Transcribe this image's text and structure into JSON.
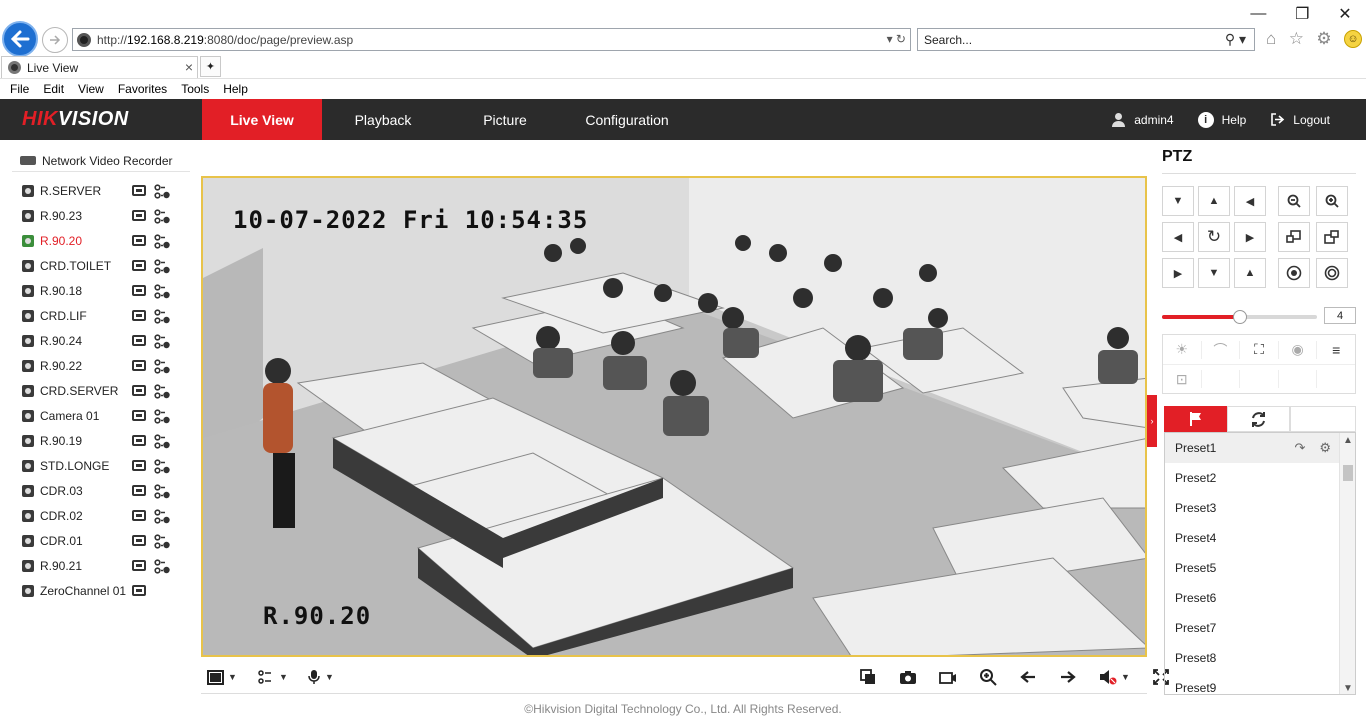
{
  "browser": {
    "url_prefix": "http://",
    "url_host": "192.168.8.219",
    "url_rest": ":8080/doc/page/preview.asp",
    "search_placeholder": "Search...",
    "tab_title": "Live View",
    "menu": [
      "File",
      "Edit",
      "View",
      "Favorites",
      "Tools",
      "Help"
    ]
  },
  "header": {
    "logo_red": "HIK",
    "logo_white": "VISION",
    "tabs": [
      "Live View",
      "Playback",
      "Picture",
      "Configuration"
    ],
    "active_tab": "Live View",
    "user": "admin4",
    "help": "Help",
    "logout": "Logout"
  },
  "tree": {
    "root": "Network Video Recorder",
    "cameras": [
      {
        "name": "R.SERVER",
        "ptz": true
      },
      {
        "name": "R.90.23",
        "ptz": true
      },
      {
        "name": "R.90.20",
        "ptz": true,
        "active": true
      },
      {
        "name": "CRD.TOILET",
        "ptz": true
      },
      {
        "name": "R.90.18",
        "ptz": true
      },
      {
        "name": "CRD.LIF",
        "ptz": true
      },
      {
        "name": "R.90.24",
        "ptz": true
      },
      {
        "name": "R.90.22",
        "ptz": true
      },
      {
        "name": "CRD.SERVER",
        "ptz": true
      },
      {
        "name": "Camera 01",
        "ptz": true
      },
      {
        "name": "R.90.19",
        "ptz": true
      },
      {
        "name": "STD.LONGE",
        "ptz": true
      },
      {
        "name": "CDR.03",
        "ptz": true
      },
      {
        "name": "CDR.02",
        "ptz": true
      },
      {
        "name": "CDR.01",
        "ptz": true
      },
      {
        "name": "R.90.21",
        "ptz": true
      },
      {
        "name": "ZeroChannel 01",
        "ptz": false
      }
    ]
  },
  "video": {
    "osd_datetime": "10-07-2022 Fri 10:54:35",
    "osd_camera": "R.90.20"
  },
  "ptz": {
    "title": "PTZ",
    "speed": "4",
    "speed_fraction": 0.5,
    "presets": [
      "Preset1",
      "Preset2",
      "Preset3",
      "Preset4",
      "Preset5",
      "Preset6",
      "Preset7",
      "Preset8",
      "Preset9"
    ]
  },
  "footer": "©Hikvision Digital Technology Co., Ltd. All Rights Reserved.",
  "colors": {
    "accent": "#e21f26",
    "header_bg": "#2b2b2b",
    "video_border": "#e8c34a"
  }
}
